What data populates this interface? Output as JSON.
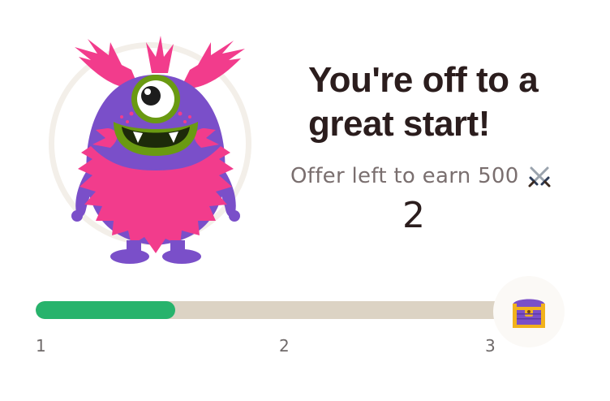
{
  "headline": "You're off to a great start!",
  "offer": {
    "label": "Offer left to earn 500",
    "icon": "crossed-swords-icon",
    "remaining": "2"
  },
  "progress": {
    "fill_fraction": 0.295,
    "steps": [
      "1",
      "2",
      "3"
    ],
    "reward_icon": "treasure-chest-icon",
    "colors": {
      "fill": "#27b36c",
      "track": "#dcd3c4"
    }
  },
  "mascot": {
    "icon": "one-eyed-monster-icon",
    "colors": {
      "fur": "#f23c8c",
      "body": "#7a4fc9",
      "mouth": "#6a9a12"
    }
  }
}
